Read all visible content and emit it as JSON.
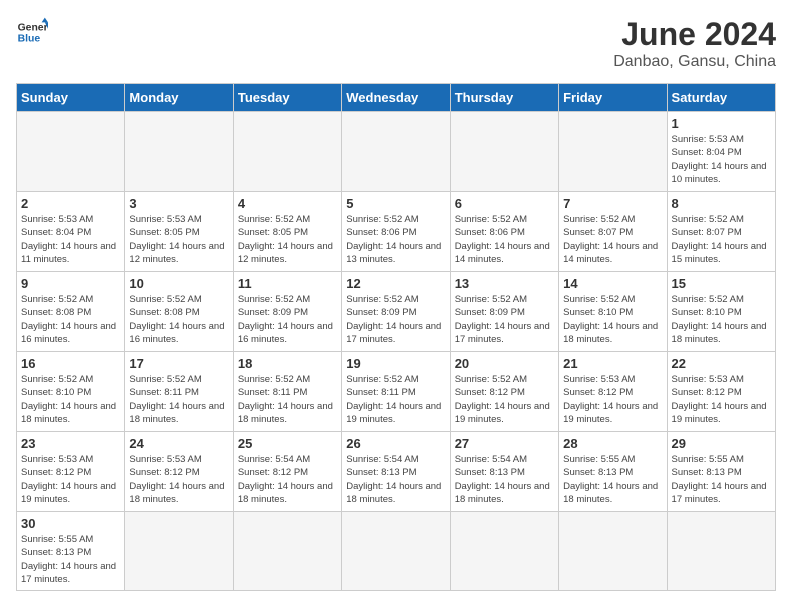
{
  "logo": {
    "text_general": "General",
    "text_blue": "Blue"
  },
  "header": {
    "title": "June 2024",
    "subtitle": "Danbao, Gansu, China"
  },
  "weekdays": [
    "Sunday",
    "Monday",
    "Tuesday",
    "Wednesday",
    "Thursday",
    "Friday",
    "Saturday"
  ],
  "days": [
    {
      "num": "",
      "info": "",
      "empty": true
    },
    {
      "num": "",
      "info": "",
      "empty": true
    },
    {
      "num": "",
      "info": "",
      "empty": true
    },
    {
      "num": "",
      "info": "",
      "empty": true
    },
    {
      "num": "",
      "info": "",
      "empty": true
    },
    {
      "num": "",
      "info": "",
      "empty": true
    },
    {
      "num": "1",
      "info": "Sunrise: 5:53 AM\nSunset: 8:04 PM\nDaylight: 14 hours and 10 minutes."
    }
  ],
  "week2": [
    {
      "num": "2",
      "info": "Sunrise: 5:53 AM\nSunset: 8:04 PM\nDaylight: 14 hours and 11 minutes."
    },
    {
      "num": "3",
      "info": "Sunrise: 5:53 AM\nSunset: 8:05 PM\nDaylight: 14 hours and 12 minutes."
    },
    {
      "num": "4",
      "info": "Sunrise: 5:52 AM\nSunset: 8:05 PM\nDaylight: 14 hours and 12 minutes."
    },
    {
      "num": "5",
      "info": "Sunrise: 5:52 AM\nSunset: 8:06 PM\nDaylight: 14 hours and 13 minutes."
    },
    {
      "num": "6",
      "info": "Sunrise: 5:52 AM\nSunset: 8:06 PM\nDaylight: 14 hours and 14 minutes."
    },
    {
      "num": "7",
      "info": "Sunrise: 5:52 AM\nSunset: 8:07 PM\nDaylight: 14 hours and 14 minutes."
    },
    {
      "num": "8",
      "info": "Sunrise: 5:52 AM\nSunset: 8:07 PM\nDaylight: 14 hours and 15 minutes."
    }
  ],
  "week3": [
    {
      "num": "9",
      "info": "Sunrise: 5:52 AM\nSunset: 8:08 PM\nDaylight: 14 hours and 16 minutes."
    },
    {
      "num": "10",
      "info": "Sunrise: 5:52 AM\nSunset: 8:08 PM\nDaylight: 14 hours and 16 minutes."
    },
    {
      "num": "11",
      "info": "Sunrise: 5:52 AM\nSunset: 8:09 PM\nDaylight: 14 hours and 16 minutes."
    },
    {
      "num": "12",
      "info": "Sunrise: 5:52 AM\nSunset: 8:09 PM\nDaylight: 14 hours and 17 minutes."
    },
    {
      "num": "13",
      "info": "Sunrise: 5:52 AM\nSunset: 8:09 PM\nDaylight: 14 hours and 17 minutes."
    },
    {
      "num": "14",
      "info": "Sunrise: 5:52 AM\nSunset: 8:10 PM\nDaylight: 14 hours and 18 minutes."
    },
    {
      "num": "15",
      "info": "Sunrise: 5:52 AM\nSunset: 8:10 PM\nDaylight: 14 hours and 18 minutes."
    }
  ],
  "week4": [
    {
      "num": "16",
      "info": "Sunrise: 5:52 AM\nSunset: 8:10 PM\nDaylight: 14 hours and 18 minutes."
    },
    {
      "num": "17",
      "info": "Sunrise: 5:52 AM\nSunset: 8:11 PM\nDaylight: 14 hours and 18 minutes."
    },
    {
      "num": "18",
      "info": "Sunrise: 5:52 AM\nSunset: 8:11 PM\nDaylight: 14 hours and 18 minutes."
    },
    {
      "num": "19",
      "info": "Sunrise: 5:52 AM\nSunset: 8:11 PM\nDaylight: 14 hours and 19 minutes."
    },
    {
      "num": "20",
      "info": "Sunrise: 5:52 AM\nSunset: 8:12 PM\nDaylight: 14 hours and 19 minutes."
    },
    {
      "num": "21",
      "info": "Sunrise: 5:53 AM\nSunset: 8:12 PM\nDaylight: 14 hours and 19 minutes."
    },
    {
      "num": "22",
      "info": "Sunrise: 5:53 AM\nSunset: 8:12 PM\nDaylight: 14 hours and 19 minutes."
    }
  ],
  "week5": [
    {
      "num": "23",
      "info": "Sunrise: 5:53 AM\nSunset: 8:12 PM\nDaylight: 14 hours and 19 minutes."
    },
    {
      "num": "24",
      "info": "Sunrise: 5:53 AM\nSunset: 8:12 PM\nDaylight: 14 hours and 18 minutes."
    },
    {
      "num": "25",
      "info": "Sunrise: 5:54 AM\nSunset: 8:12 PM\nDaylight: 14 hours and 18 minutes."
    },
    {
      "num": "26",
      "info": "Sunrise: 5:54 AM\nSunset: 8:13 PM\nDaylight: 14 hours and 18 minutes."
    },
    {
      "num": "27",
      "info": "Sunrise: 5:54 AM\nSunset: 8:13 PM\nDaylight: 14 hours and 18 minutes."
    },
    {
      "num": "28",
      "info": "Sunrise: 5:55 AM\nSunset: 8:13 PM\nDaylight: 14 hours and 18 minutes."
    },
    {
      "num": "29",
      "info": "Sunrise: 5:55 AM\nSunset: 8:13 PM\nDaylight: 14 hours and 17 minutes."
    }
  ],
  "week6": [
    {
      "num": "30",
      "info": "Sunrise: 5:55 AM\nSunset: 8:13 PM\nDaylight: 14 hours and 17 minutes."
    },
    {
      "num": "",
      "info": "",
      "empty": true
    },
    {
      "num": "",
      "info": "",
      "empty": true
    },
    {
      "num": "",
      "info": "",
      "empty": true
    },
    {
      "num": "",
      "info": "",
      "empty": true
    },
    {
      "num": "",
      "info": "",
      "empty": true
    },
    {
      "num": "",
      "info": "",
      "empty": true
    }
  ]
}
